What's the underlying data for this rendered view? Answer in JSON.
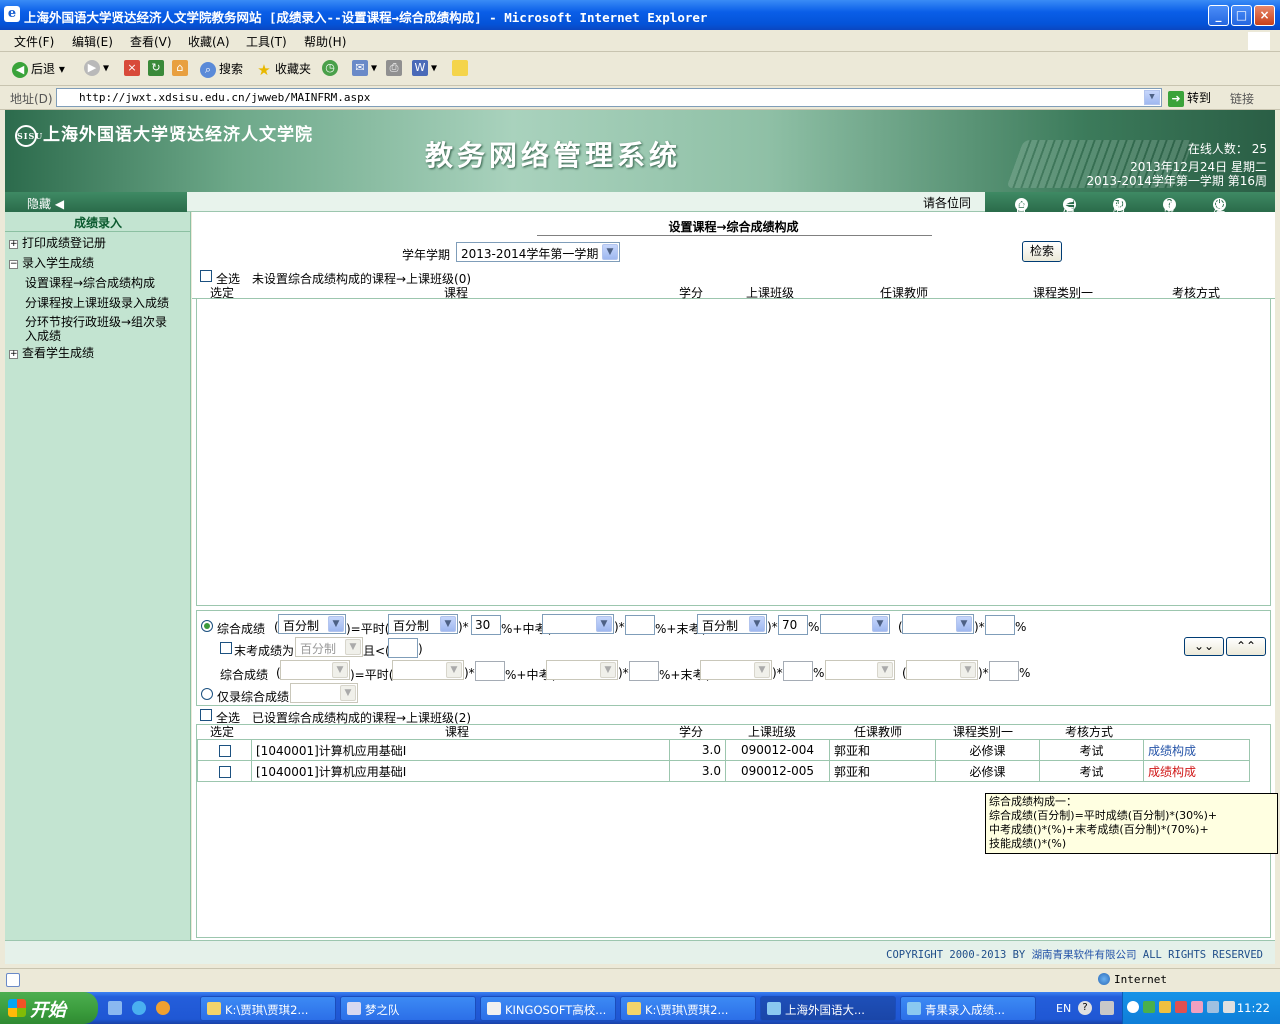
{
  "window": {
    "title": "上海外国语大学贤达经济人文学院教务网站 [成绩录入--设置课程→综合成绩构成] - Microsoft Internet Explorer",
    "min": "_",
    "max": "□",
    "close": "×"
  },
  "menu": [
    "文件(F)",
    "编辑(E)",
    "查看(V)",
    "收藏(A)",
    "工具(T)",
    "帮助(H)"
  ],
  "toolbar": {
    "back": "后退",
    "search": "搜索",
    "favorites": "收藏夹"
  },
  "address": {
    "label": "地址(D)",
    "url": "http://jwxt.xdsisu.edu.cn/jwweb/MAINFRM.aspx",
    "go": "转到",
    "links": "链接"
  },
  "banner": {
    "school": "上海外国语大学贤达经济人文学院",
    "system": "教务网络管理系统",
    "online": "在线人数： 25",
    "date": "2013年12月24日 星期二",
    "term": "2013-2014学年第一学期 第16周"
  },
  "nav": {
    "hide": "隐藏",
    "where": "请各位同",
    "quick": [
      "首页",
      "后退",
      "刷新",
      "帮助",
      "注销"
    ]
  },
  "sidebar": {
    "header": "成绩录入",
    "items": [
      {
        "label": "打印成绩登记册",
        "pm": "+"
      },
      {
        "label": "录入学生成绩",
        "pm": "−"
      },
      {
        "label": "设置课程→综合成绩构成"
      },
      {
        "label": "分课程按上课班级录入成绩"
      },
      {
        "label": "分环节按行政班级→组次录"
      },
      {
        "label": "入成绩"
      },
      {
        "label": "查看学生成绩",
        "pm": "+"
      }
    ]
  },
  "content": {
    "title": "设置课程→综合成绩构成",
    "term_label": "学年学期",
    "term_value": "2013-2014学年第一学期",
    "search_btn": "检索",
    "select_all": "全选",
    "unset_label": "未设置综合成绩构成的课程→上课班级(0)",
    "set_label": "已设置综合成绩构成的课程→上课班级(2)",
    "columns": [
      "选定",
      "课程",
      "学分",
      "上课班级",
      "任课教师",
      "课程类别一",
      "考核方式"
    ],
    "formula": {
      "radio1": "综合成绩",
      "grade_type": "百分制",
      "eq_regular": ")=平时(",
      "regular_type": "百分制",
      "regular_pct": "30",
      "mid_label": "%+中考(",
      "final_label": "%+末考(",
      "final_type": "百分制",
      "final_pct": "70",
      "pct_plus": "%+",
      "pct": "%",
      "star": ")*",
      "paren": "(",
      "final_score_label": "末考成绩为",
      "final_score_type": "百分制",
      "and_lt": "且<(",
      "close_paren": ")",
      "line3_label": "综合成绩",
      "radio2": "仅录综合成绩"
    },
    "rows": [
      {
        "course": "[1040001]计算机应用基础I",
        "credit": "3.0",
        "class": "090012-004",
        "teacher": "郭亚和",
        "category": "必修课",
        "exam": "考试",
        "link": "成绩构成"
      },
      {
        "course": "[1040001]计算机应用基础I",
        "credit": "3.0",
        "class": "090012-005",
        "teacher": "郭亚和",
        "category": "必修课",
        "exam": "考试",
        "link": "成绩构成"
      }
    ],
    "tooltip": [
      "综合成绩构成一：",
      "综合成绩(百分制)=平时成绩(百分制)*(30%)+",
      "中考成绩()*(%)+末考成绩(百分制)*(70%)+",
      "技能成绩()*(%)"
    ]
  },
  "footer": {
    "prefix": "COPYRIGHT 2000-2013 BY ",
    "company": "湖南青果软件有限公司",
    "suffix": " ALL RIGHTS RESERVED"
  },
  "status": {
    "zone": "Internet"
  },
  "taskbar": {
    "start": "开始",
    "tasks": [
      "K:\\贾琪\\贾琪2...",
      "梦之队",
      "KINGOSOFT高校...",
      "K:\\贾琪\\贾琪2...",
      "上海外国语大...",
      "青果录入成绩..."
    ],
    "lang": "EN",
    "clock": "11:22"
  },
  "colors": {
    "accent_green": "#2a6b4a",
    "sidebar_bg": "#c3e4d1",
    "link_blue": "#2554a8",
    "link_red": "#d01818"
  }
}
